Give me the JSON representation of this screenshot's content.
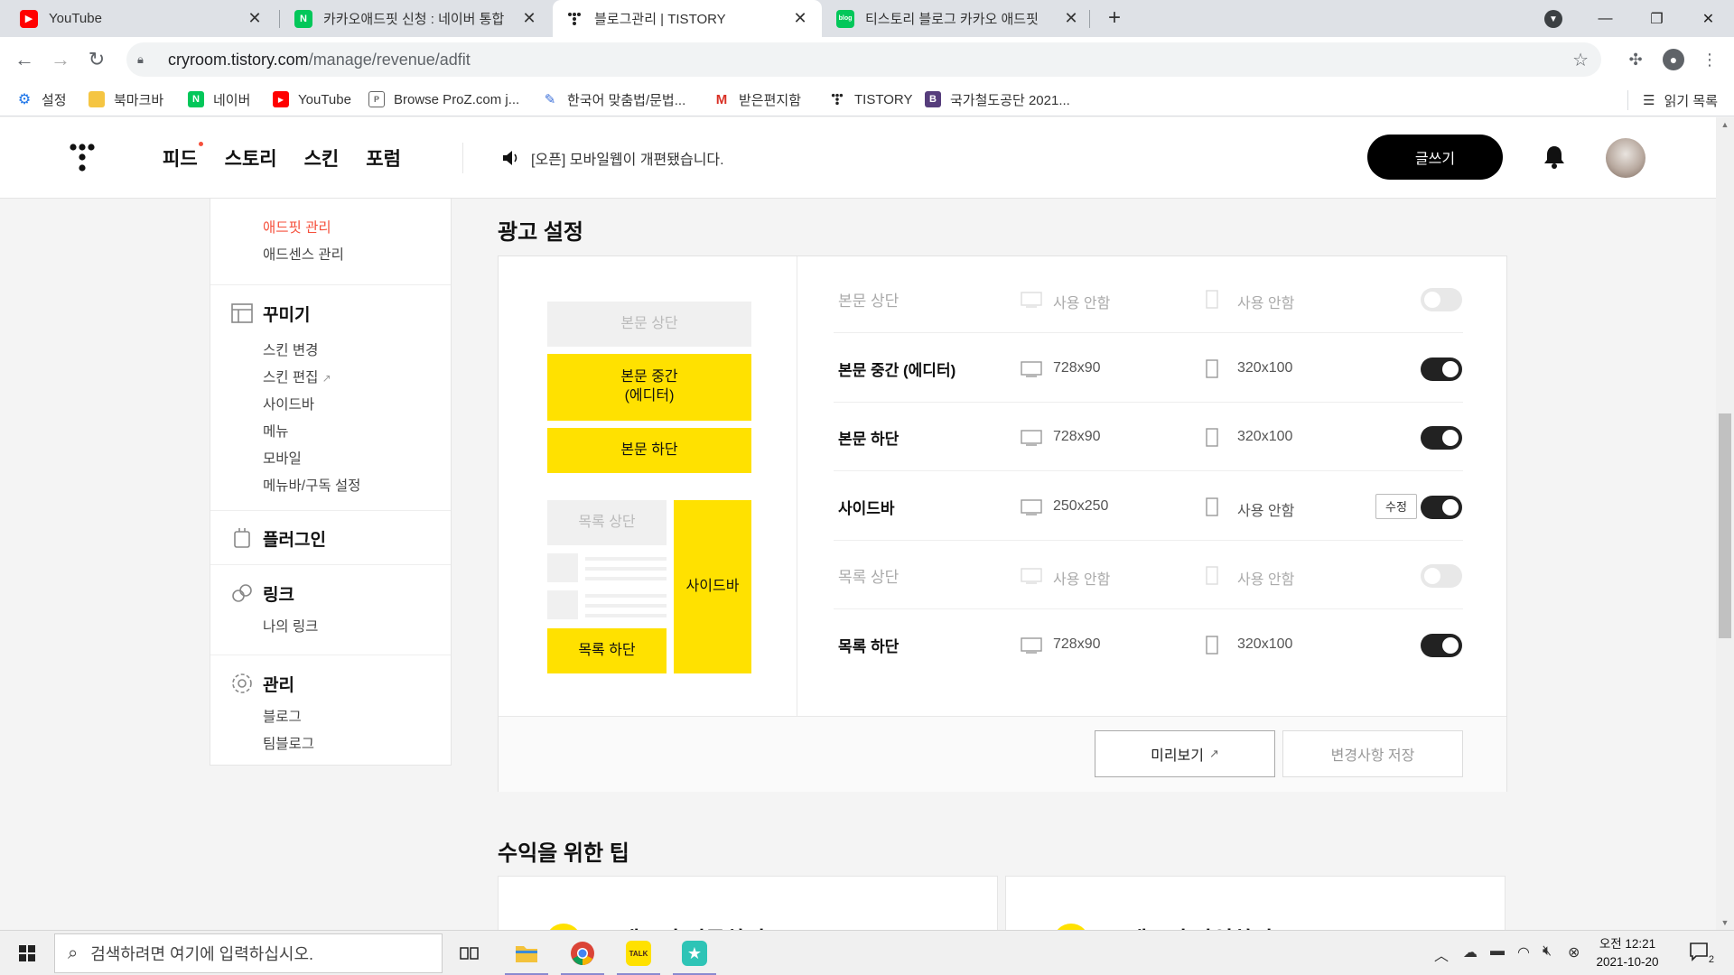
{
  "browser": {
    "tabs": [
      {
        "title": "YouTube",
        "favicon": "youtube-icon"
      },
      {
        "title": "카카오애드핏 신청 : 네이버 통합",
        "favicon": "naver-icon"
      },
      {
        "title": "블로그관리 | TISTORY",
        "favicon": "tistory-icon"
      },
      {
        "title": "티스토리 블로그 카카오 애드핏",
        "favicon": "naver-blog-icon"
      }
    ],
    "url_host": "cryroom.tistory.com",
    "url_path": "/manage/revenue/adfit",
    "bookmarks": [
      "설정",
      "북마크바",
      "네이버",
      "YouTube",
      "Browse ProZ.com j...",
      "한국어 맞춤법/문법...",
      "받은편지함",
      "TISTORY",
      "국가철도공단 2021..."
    ],
    "reading_list": "읽기 목록"
  },
  "header": {
    "nav": [
      "피드",
      "스토리",
      "스킨",
      "포럼"
    ],
    "notice": "[오픈] 모바일웹이 개편됐습니다.",
    "write_label": "글쓰기"
  },
  "sidebar": {
    "revenue_items": [
      "애드핏 관리",
      "애드센스 관리"
    ],
    "decorate": {
      "title": "꾸미기",
      "items": [
        "스킨 변경",
        "스킨 편집",
        "사이드바",
        "메뉴",
        "모바일",
        "메뉴바/구독 설정"
      ]
    },
    "plugin": {
      "title": "플러그인"
    },
    "link": {
      "title": "링크",
      "items": [
        "나의 링크"
      ]
    },
    "manage": {
      "title": "관리",
      "items": [
        "블로그",
        "팀블로그"
      ]
    }
  },
  "ad_settings": {
    "title": "광고 설정",
    "preview": {
      "top": "본문 상단",
      "middle_line1": "본문 중간",
      "middle_line2": "(에디터)",
      "bottom": "본문 하단",
      "list_top": "목록 상단",
      "sidebar": "사이드바",
      "list_bottom": "목록 하단"
    },
    "rows": [
      {
        "name": "본문 상단",
        "pc": "사용 안함",
        "mobile": "사용 안함",
        "enabled": false
      },
      {
        "name": "본문 중간 (에디터)",
        "pc": "728x90",
        "mobile": "320x100",
        "enabled": true
      },
      {
        "name": "본문 하단",
        "pc": "728x90",
        "mobile": "320x100",
        "enabled": true
      },
      {
        "name": "사이드바",
        "pc": "250x250",
        "mobile": "사용 안함",
        "enabled": true,
        "edit_label": "수정"
      },
      {
        "name": "목록 상단",
        "pc": "사용 안함",
        "mobile": "사용 안함",
        "enabled": false
      },
      {
        "name": "목록 하단",
        "pc": "728x90",
        "mobile": "320x100",
        "enabled": true
      }
    ],
    "preview_button": "미리보기",
    "save_button": "변경사항 저장"
  },
  "tips": {
    "title": "수익을 위한 팁",
    "cards": [
      "애드핏 연동하기",
      "애드핏 가입하기"
    ]
  },
  "taskbar": {
    "search_placeholder": "검색하려면 여기에 입력하십시오.",
    "time": "오전 12:21",
    "date": "2021-10-20",
    "notification_count": "2"
  },
  "colors": {
    "accent_yellow": "#ffe100",
    "active_red": "#f5503c",
    "toggle_on": "#222222"
  }
}
